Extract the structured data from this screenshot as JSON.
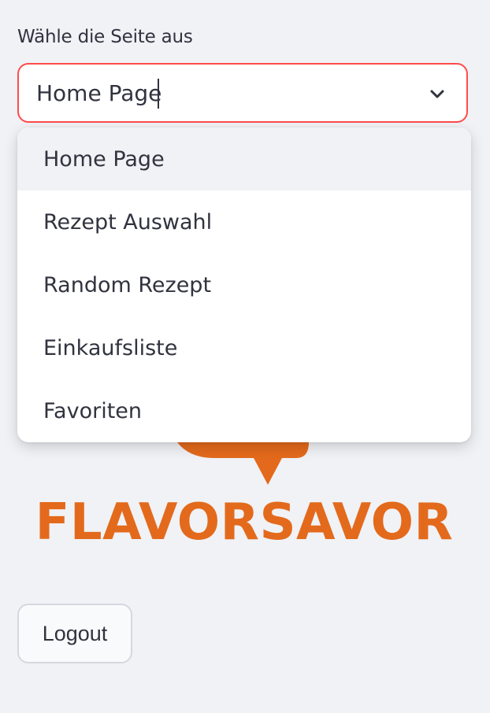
{
  "select": {
    "label": "Wähle die Seite aus",
    "value": "Home Page",
    "focus_color": "#ff4b4b",
    "icon": "chevron-down-icon"
  },
  "dropdown": {
    "options": [
      {
        "label": "Home Page",
        "highlighted": true
      },
      {
        "label": "Rezept Auswahl",
        "highlighted": false
      },
      {
        "label": "Random Rezept",
        "highlighted": false
      },
      {
        "label": "Einkaufsliste",
        "highlighted": false
      },
      {
        "label": "Favoriten",
        "highlighted": false
      }
    ]
  },
  "logo": {
    "text": "FLAVORSAVOR",
    "color": "#e36a1c"
  },
  "logout": {
    "label": "Logout"
  },
  "theme": {
    "background": "#f0f2f6",
    "text": "#31333f"
  }
}
